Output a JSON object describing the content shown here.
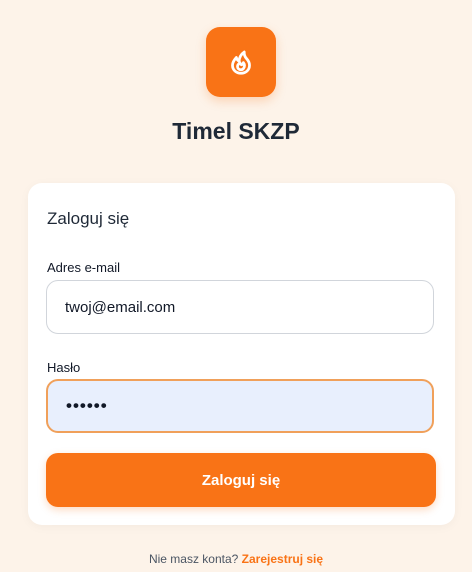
{
  "app": {
    "title": "Timel SKZP",
    "logo_icon": "flame-icon",
    "accent_color": "#f97316"
  },
  "login_card": {
    "heading": "Zaloguj się",
    "email_label": "Adres e-mail",
    "email_value": "twoj@email.com",
    "password_label": "Hasło",
    "password_value": "••••••",
    "submit_label": "Zaloguj się"
  },
  "footer": {
    "prompt": "Nie masz konta?",
    "register_link": "Zarejestruj się"
  }
}
